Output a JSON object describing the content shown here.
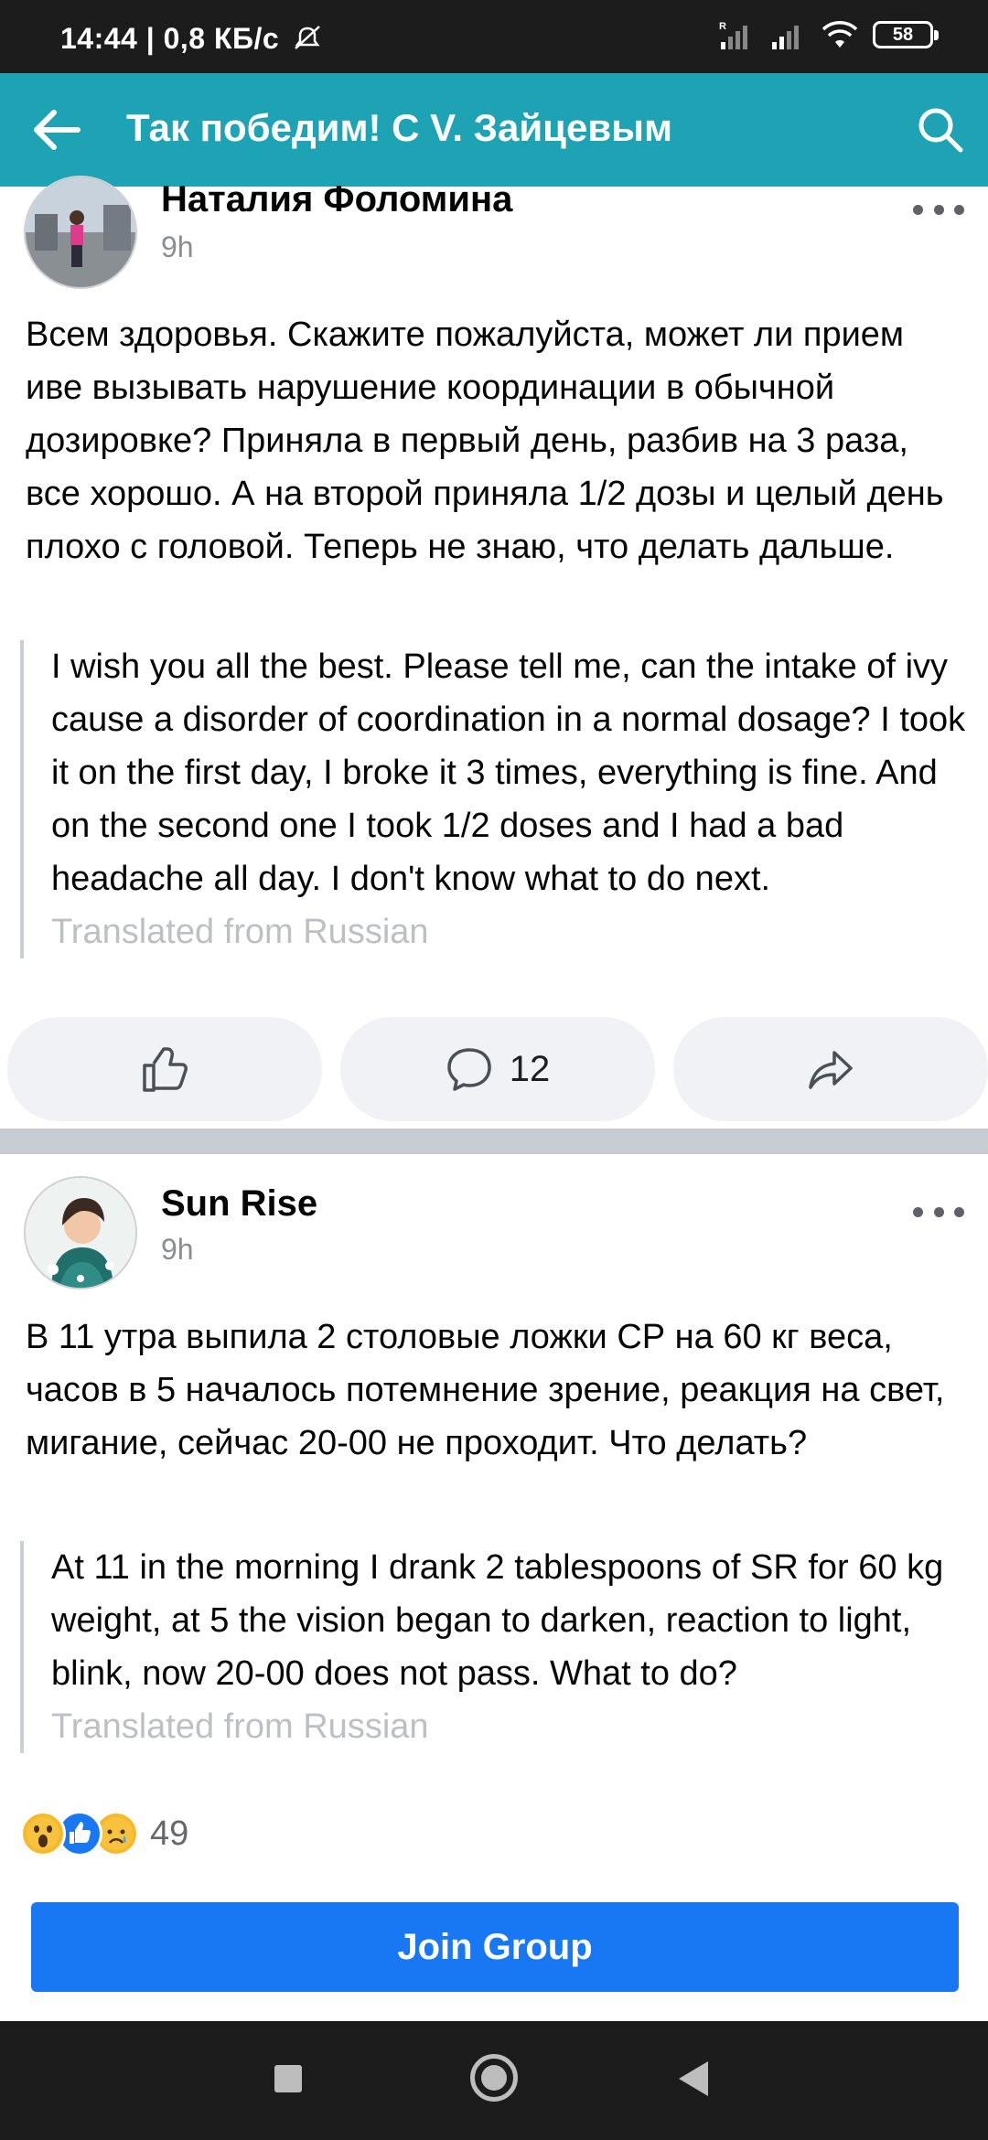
{
  "status_bar": {
    "time_speed": "14:44 | 0,8 КБ/с",
    "battery": "58",
    "icons": [
      "mute-icon",
      "signal-icon",
      "signal-icon",
      "wifi-icon",
      "battery-icon"
    ]
  },
  "app_bar": {
    "title": "Так победим! С V. Зайцевым",
    "back_icon": "arrow-left-icon",
    "search_icon": "search-icon",
    "color": "#1ea3b5"
  },
  "posts": [
    {
      "author": "Наталия Фоломина",
      "time": "9h",
      "text": "Всем здоровья. Скажите пожалуйста, может ли прием иве вызывать нарушение координации в обычной дозировке? Приняла в первый день, разбив на 3 раза, все хорошо. А на второй приняла 1/2 дозы и целый день плохо с головой. Теперь не знаю, что делать дальше.",
      "translation": "I wish you all the best. Please tell me, can the intake of ivy cause a disorder of coordination in a normal dosage? I took it on the first day, I broke it 3 times, everything is fine. And on the second one I took 1/2 doses and I had a bad headache all day. I don't know what to do next.",
      "translated_from": "Translated from Russian",
      "comments_count": "12"
    },
    {
      "author": "Sun Rise",
      "time": "9h",
      "text": "В 11 утра выпила 2 столовые ложки СР на 60 кг веса, часов в 5 началось потемнение зрение, реакция на свет, мигание, сейчас 20-00 не проходит. Что делать?",
      "translation": "At 11 in the morning I drank 2 tablespoons of SR for 60 kg weight, at 5 the vision began to darken, reaction to light, blink, now 20-00 does not pass. What to do?",
      "translated_from": "Translated from Russian",
      "reactions_count": "49",
      "reaction_icons": [
        "wow-icon",
        "like-icon",
        "sad-icon"
      ]
    }
  ],
  "join_button": "Join Group",
  "colors": {
    "accent": "#1877f2",
    "bar": "#1ea3b5"
  }
}
